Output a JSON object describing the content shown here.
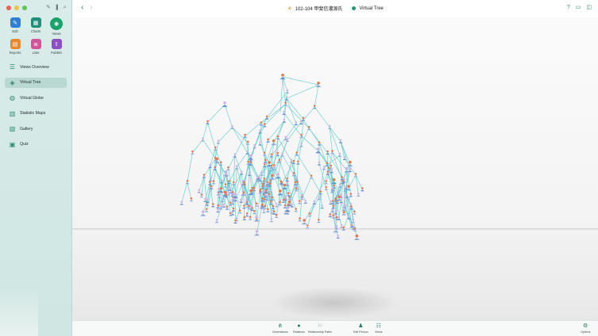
{
  "window": {
    "title": "102-104  甲斐信濃源氏",
    "view_title": "Virtual Tree"
  },
  "sidebar": {
    "apps": [
      {
        "label": "Edit",
        "icon": "pencil-icon",
        "color": "#2f7fd6"
      },
      {
        "label": "Charts",
        "icon": "charts-icon",
        "color": "#1f8f7a"
      },
      {
        "label": "Views",
        "icon": "eye-icon",
        "color": "#19a36b"
      },
      {
        "label": "Reports",
        "icon": "reports-icon",
        "color": "#e8892f"
      },
      {
        "label": "Lists",
        "icon": "lists-icon",
        "color": "#d0569a"
      },
      {
        "label": "Publish",
        "icon": "publish-icon",
        "color": "#8c4fc4"
      }
    ],
    "nav_items": [
      {
        "label": "Views Overview",
        "icon": "list-icon"
      },
      {
        "label": "Virtual Tree",
        "icon": "cube-icon"
      },
      {
        "label": "Virtual Globe",
        "icon": "globe-icon"
      },
      {
        "label": "Statistic Maps",
        "icon": "map-icon"
      },
      {
        "label": "Gallery",
        "icon": "gallery-icon"
      },
      {
        "label": "Quiz",
        "icon": "quiz-icon"
      }
    ],
    "selected": "Virtual Tree"
  },
  "bottom_bar": {
    "buttons": [
      {
        "label": "Generations",
        "icon": "generations-icon"
      },
      {
        "label": "Relatives",
        "icon": "relatives-icon"
      },
      {
        "label": "Relationship Paths",
        "icon": "relationship-paths-icon"
      },
      {
        "label": "Edit Person",
        "icon": "edit-person-icon"
      },
      {
        "label": "Views",
        "icon": "views-icon"
      },
      {
        "label": "Options",
        "icon": "options-icon"
      }
    ]
  },
  "colors": {
    "accent": "#1f7a64",
    "sidebar_bg": "#d3e8e4",
    "selected_bg": "#b9d8d2",
    "tree_line": "#5ec9c9",
    "node_female": "#e07a4f",
    "node_male": "#6a8fd0"
  }
}
